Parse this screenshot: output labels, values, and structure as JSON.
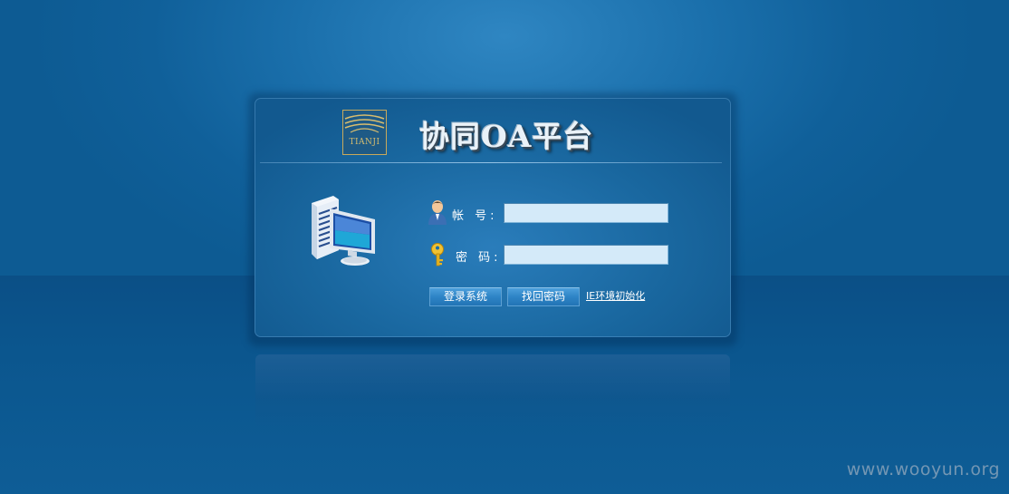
{
  "header": {
    "logo_text": "TIANJI",
    "title": "协同OA平台"
  },
  "form": {
    "username_label": "帐 号:",
    "username_value": "",
    "password_label": "密 码:",
    "password_value": ""
  },
  "actions": {
    "login_label": "登录系统",
    "find_password_label": "找回密码",
    "ie_init_label": "IE环境初始化"
  },
  "watermark": "www.wooyun.org",
  "icons": {
    "logo": "tianji-logo",
    "computer": "computer-server-icon",
    "user": "user-icon",
    "key": "key-icon"
  },
  "colors": {
    "background": "#0d5e93",
    "panel": "#19679f",
    "input_bg": "#d4eaf9",
    "button": "#2e84c6",
    "logo_gold": "#c9a95a"
  }
}
